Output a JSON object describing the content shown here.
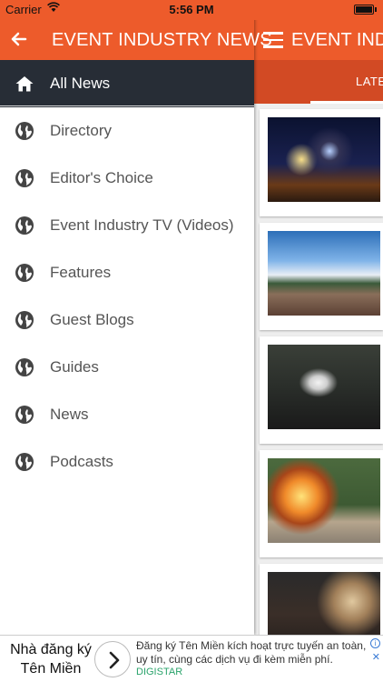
{
  "status_bar": {
    "carrier": "Carrier",
    "time": "5:56 PM",
    "wifi_icon": "wifi-icon",
    "battery_level": 1.0
  },
  "drawer": {
    "title": "EVENT INDUSTRY NEWS",
    "back_icon": "arrow-left-icon",
    "items": [
      {
        "label": "All News",
        "icon": "home-icon",
        "active": true
      },
      {
        "label": "Directory",
        "icon": "globe-icon"
      },
      {
        "label": "Editor's Choice",
        "icon": "globe-icon"
      },
      {
        "label": "Event Industry TV (Videos)",
        "icon": "globe-icon"
      },
      {
        "label": "Features",
        "icon": "globe-icon"
      },
      {
        "label": "Guest Blogs",
        "icon": "globe-icon"
      },
      {
        "label": "Guides",
        "icon": "globe-icon"
      },
      {
        "label": "News",
        "icon": "globe-icon"
      },
      {
        "label": "Podcasts",
        "icon": "globe-icon"
      }
    ]
  },
  "background_screen": {
    "title": "EVENT INDU",
    "menu_icon": "hamburger-icon",
    "tab_label": "LATE"
  },
  "ad": {
    "brand": "Nhà đăng ký Tên Miền",
    "text": "Đăng ký Tên Miền kích hoạt trực tuyến an toàn, uy tín, cùng các dịch vụ đi kèm miễn phí.",
    "source": "DIGISTAR"
  },
  "colors": {
    "accent": "#ed5b2b",
    "tab_bar": "#d24a24",
    "active_item": "#272d36",
    "text": "#555555"
  }
}
